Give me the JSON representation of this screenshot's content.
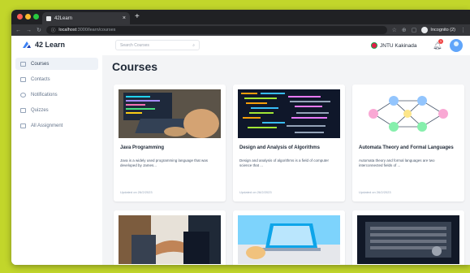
{
  "browser": {
    "tab_title": "42Learn",
    "tab_close": "×",
    "new_tab": "+",
    "url_host": "localhost",
    "url_path": ":3000/learn/courses",
    "incognito_label": "Incognito (2)"
  },
  "app": {
    "logo_text": "42 Learn",
    "search_placeholder": "Search Courses",
    "institution": "JNTU Kakinada",
    "notification_count": "1"
  },
  "sidebar": {
    "items": [
      {
        "label": "Courses",
        "icon": "book-icon",
        "active": true
      },
      {
        "label": "Contacts",
        "icon": "contacts-icon",
        "active": false
      },
      {
        "label": "Notifications",
        "icon": "bell-icon",
        "active": false
      },
      {
        "label": "Quizzes",
        "icon": "quiz-icon",
        "active": false
      },
      {
        "label": "All Assignment",
        "icon": "assignment-icon",
        "active": false
      }
    ]
  },
  "main": {
    "title": "Courses",
    "courses": [
      {
        "title": "Java Programming",
        "description": "Java is a widely used programming language that was developed by James...",
        "updated": "Updated on 26/2/2023"
      },
      {
        "title": "Design and Analysis of Algorithms",
        "description": "Design and analysis of algorithms is a field of computer science that ...",
        "updated": "Updated on 26/2/2023"
      },
      {
        "title": "Automata Theory and Formal Languages",
        "description": "Automata theory and formal languages are two interconnected fields of ...",
        "updated": "Updated on 26/2/2023"
      },
      {
        "title": "",
        "description": "",
        "updated": ""
      },
      {
        "title": "",
        "description": "",
        "updated": ""
      },
      {
        "title": "",
        "description": "",
        "updated": ""
      }
    ]
  },
  "colors": {
    "background": "#c2d62b",
    "accent": "#2563eb"
  }
}
